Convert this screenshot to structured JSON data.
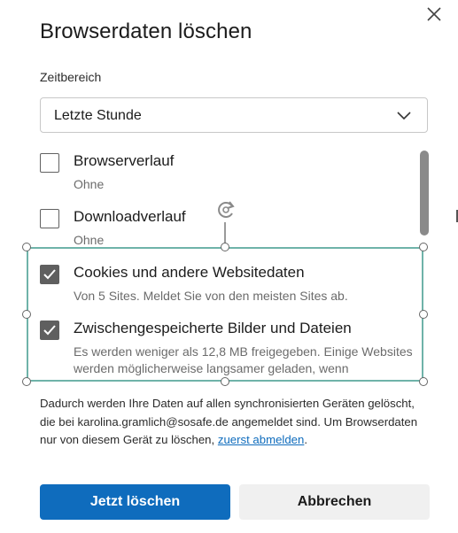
{
  "dialog": {
    "title": "Browserdaten löschen",
    "close_icon": "close-icon"
  },
  "time_range": {
    "label": "Zeitbereich",
    "selected": "Letzte Stunde"
  },
  "items": [
    {
      "title": "Browserverlauf",
      "desc": "Ohne",
      "checked": false
    },
    {
      "title": "Downloadverlauf",
      "desc": "Ohne",
      "checked": false
    },
    {
      "title": "Cookies und andere Websitedaten",
      "desc": "Von 5 Sites. Meldet Sie von den meisten Sites ab.",
      "checked": true
    },
    {
      "title": "Zwischengespeicherte Bilder und Dateien",
      "desc": "Es werden weniger als 12,8 MB freigegeben. Einige Websites werden möglicherweise langsamer geladen, wenn",
      "checked": true
    }
  ],
  "info": {
    "text": "Dadurch werden Ihre Daten auf allen synchronisierten Geräten gelöscht, die bei karolina.gramlich@sosafe.de angemeldet sind. Um Browserdaten nur von diesem Gerät zu löschen, ",
    "link": "zuerst abmelden",
    "tail": "."
  },
  "buttons": {
    "primary": "Jetzt löschen",
    "secondary": "Abbrechen"
  },
  "colors": {
    "accent": "#0f6cbd",
    "selection": "#6fb3a9",
    "checkbox_checked": "#5f5f5f"
  }
}
